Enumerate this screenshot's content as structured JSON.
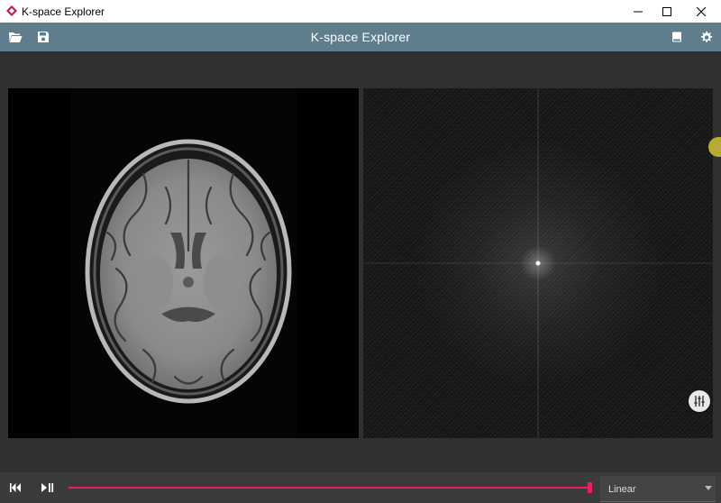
{
  "window": {
    "title": "K-space Explorer",
    "controls": {
      "minimize": "minimize-icon",
      "maximize": "maximize-icon",
      "close": "close-icon"
    }
  },
  "toolbar": {
    "title": "K-space Explorer",
    "icons": {
      "open": "folder-open-icon",
      "save": "floppy-disk-icon",
      "panel": "panel-toggle-icon",
      "settings": "gear-icon"
    }
  },
  "panels": {
    "image": "brain-mri-axial",
    "kspace": "k-space-spectrum"
  },
  "side_handle": {
    "icon": "drawer-handle-icon",
    "color": "#b9a935"
  },
  "fab": {
    "icon": "sliders-icon"
  },
  "playback": {
    "icons": {
      "rewind": "skip-back-icon",
      "play_pause": "play-pause-icon"
    },
    "progress": 1.0,
    "accent": "#e91e63"
  },
  "interpolation": {
    "selected": "Linear"
  },
  "colors": {
    "toolbar": "#5f7d8c",
    "background": "#303030",
    "bottombar": "#3b3b3b"
  }
}
